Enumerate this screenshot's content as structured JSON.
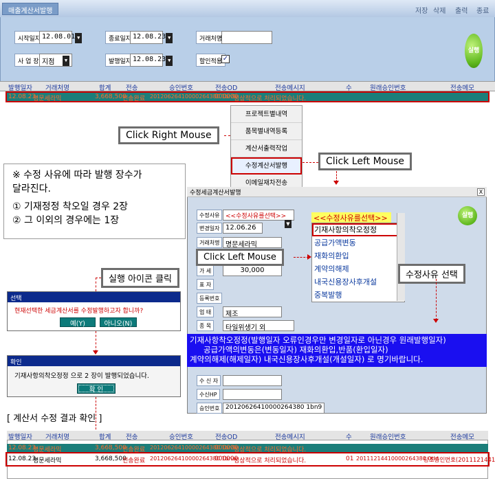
{
  "top": {
    "tab": "매출계산서발행",
    "toolbar": [
      "저장",
      "삭제",
      "출력",
      "종료"
    ],
    "labels": {
      "start": "시작일자",
      "site": "사 업 장",
      "send_date": "종료일자",
      "issue_date": "발행일자",
      "buyer": "거래처명",
      "discount": "할인적용"
    },
    "values": {
      "start": "12.08.01",
      "site": "지점",
      "send_date": "12.08.23",
      "issue_date": "12.08.23",
      "buyer": "",
      "discount_check": "✓"
    },
    "exec": "실행"
  },
  "grid_top": {
    "headers": [
      "발행일자",
      "거래처명",
      "합계",
      "전송",
      "승인번호",
      "전송OD",
      "전송메시지",
      "수",
      "원래승인번호",
      "전송메모"
    ],
    "row": {
      "date": "12.08.23",
      "name": "명문세라믹",
      "sum": "3,668,500",
      "status": "전송완료",
      "approval": "20120626410000264380 1bn9",
      "code": "000000",
      "msg": "정상적으로 처리되었습니다."
    }
  },
  "context_menu": [
    "프로젝트별내역",
    "품목별내역등록",
    "계산서출력작업",
    "수정계산서발행",
    "이메일재차전송"
  ],
  "callouts": {
    "right": "Click Right Mouse",
    "left1": "Click Left Mouse",
    "left2": "Click Left Mouse",
    "exec_click": "실행 아이콘 클릭",
    "reason_select": "수정사유 선택"
  },
  "note": {
    "l1": "※ 수정 사유에 따라 발행 장수가",
    "l2": "달라진다.",
    "l3": "① 기재정정 착오일 경우 2장",
    "l4": "② 그 이외의 경우에는 1장"
  },
  "sub": {
    "title": "수정세금계산서발행",
    "close": "X",
    "labels": {
      "reason": "수정사유",
      "change": "변경일자",
      "buyer": "거래처명",
      "price": "가 세",
      "ceo": "표 자",
      "reg": "등록번호",
      "biz": "업 태",
      "item": "종 목",
      "receiver": "수 신 자",
      "hp": "수신HP",
      "approval": "승인번호"
    },
    "values": {
      "reason": "<<수정사유를선택>>",
      "change": "12.06.26",
      "buyer": "명문세라믹",
      "price": "30,000",
      "biz": "제조",
      "item": "타일위생기 외",
      "approval": "20120626410000264380 1bn9"
    },
    "exec": "실행",
    "list_header": "<<수정사유를선택>>",
    "list": [
      "기재사항의착오정정",
      "공급가액변동",
      "재화의환입",
      "계약의해제",
      "내국신용장사후개설",
      "중복발행"
    ],
    "banner": [
      "기재사항착오정정(발행일자 오류인경우만 변경일자로 아닌경우 원래발행일자)",
      "공급가액의변동은(변동일자) 재화의환입,반품(환입일자)",
      "계약의해제(해제일자) 내국신용장사후개설(개설일자) 로 명기바랍니다."
    ]
  },
  "dlg1": {
    "title": "선택",
    "msg": "현재선택한 세금계산서를 수정발행하고자 합니까?",
    "yes": "예(Y)",
    "no": "아니오(N)"
  },
  "dlg2": {
    "title": "확인",
    "msg": "기재사항의착오정정 으로 2 장이 발행되었습니다.",
    "ok": "확 인"
  },
  "result_caption": "[ 계산서 수정 결과 확인 ]",
  "grid_bottom": {
    "headers": [
      "발행일자",
      "거래처명",
      "합계",
      "전송",
      "승인번호",
      "전송OD",
      "전송메시지",
      "수",
      "원래승인번호",
      "전송메모"
    ],
    "row1": {
      "date": "12.08.23",
      "name": "명문세라믹",
      "sum": "3,668,500",
      "status": "전송완료",
      "approval": "20120626410000264380 1bn9",
      "code": "000000",
      "msg": "정상적으로 처리되었습니다."
    },
    "row2": {
      "date": "12.08.23",
      "name": "명문세라믹",
      "sum": "3,668,500",
      "status": "전송완료",
      "approval": "20120626410000264380 1bna",
      "code": "000000",
      "msg": "정상적으로 처리되었습니다.",
      "cnt": "01",
      "orig": "20111214410000264380 0tht",
      "memo": "당초승인번호(20111214410"
    }
  }
}
